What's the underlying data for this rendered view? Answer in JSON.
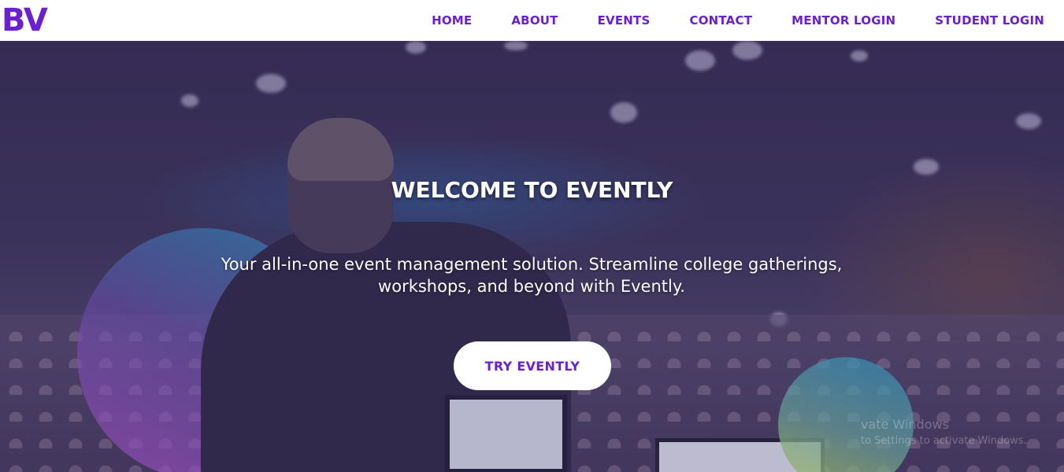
{
  "logo": "BV",
  "nav": {
    "items": [
      {
        "label": "HOME"
      },
      {
        "label": "ABOUT"
      },
      {
        "label": "EVENTS"
      },
      {
        "label": "CONTACT"
      },
      {
        "label": "MENTOR LOGIN"
      },
      {
        "label": "STUDENT LOGIN"
      }
    ]
  },
  "hero": {
    "title": "WELCOME TO EVENTLY",
    "subtitle": "Your all-in-one event management solution. Streamline college gatherings, workshops, and beyond with Evently.",
    "cta_label": "TRY EVENTLY"
  },
  "watermark": {
    "title": "vate Windows",
    "subtitle": "to Settings to activate Windows."
  },
  "colors": {
    "brand": "#6a1fd1",
    "navbar_bg": "#ffffff",
    "hero_text": "#ffffff",
    "cta_bg": "#ffffff"
  },
  "icons": {
    "logo": "bv-logo"
  }
}
